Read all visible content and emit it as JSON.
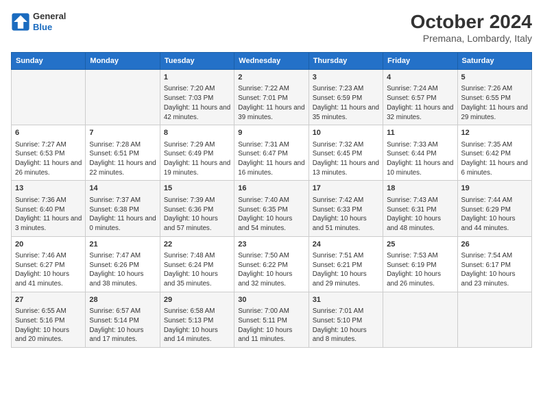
{
  "header": {
    "title": "October 2024",
    "subtitle": "Premana, Lombardy, Italy",
    "logo_line1": "General",
    "logo_line2": "Blue"
  },
  "days_of_week": [
    "Sunday",
    "Monday",
    "Tuesday",
    "Wednesday",
    "Thursday",
    "Friday",
    "Saturday"
  ],
  "weeks": [
    [
      {
        "day": "",
        "info": ""
      },
      {
        "day": "",
        "info": ""
      },
      {
        "day": "1",
        "info": "Sunrise: 7:20 AM\nSunset: 7:03 PM\nDaylight: 11 hours and 42 minutes."
      },
      {
        "day": "2",
        "info": "Sunrise: 7:22 AM\nSunset: 7:01 PM\nDaylight: 11 hours and 39 minutes."
      },
      {
        "day": "3",
        "info": "Sunrise: 7:23 AM\nSunset: 6:59 PM\nDaylight: 11 hours and 35 minutes."
      },
      {
        "day": "4",
        "info": "Sunrise: 7:24 AM\nSunset: 6:57 PM\nDaylight: 11 hours and 32 minutes."
      },
      {
        "day": "5",
        "info": "Sunrise: 7:26 AM\nSunset: 6:55 PM\nDaylight: 11 hours and 29 minutes."
      }
    ],
    [
      {
        "day": "6",
        "info": "Sunrise: 7:27 AM\nSunset: 6:53 PM\nDaylight: 11 hours and 26 minutes."
      },
      {
        "day": "7",
        "info": "Sunrise: 7:28 AM\nSunset: 6:51 PM\nDaylight: 11 hours and 22 minutes."
      },
      {
        "day": "8",
        "info": "Sunrise: 7:29 AM\nSunset: 6:49 PM\nDaylight: 11 hours and 19 minutes."
      },
      {
        "day": "9",
        "info": "Sunrise: 7:31 AM\nSunset: 6:47 PM\nDaylight: 11 hours and 16 minutes."
      },
      {
        "day": "10",
        "info": "Sunrise: 7:32 AM\nSunset: 6:45 PM\nDaylight: 11 hours and 13 minutes."
      },
      {
        "day": "11",
        "info": "Sunrise: 7:33 AM\nSunset: 6:44 PM\nDaylight: 11 hours and 10 minutes."
      },
      {
        "day": "12",
        "info": "Sunrise: 7:35 AM\nSunset: 6:42 PM\nDaylight: 11 hours and 6 minutes."
      }
    ],
    [
      {
        "day": "13",
        "info": "Sunrise: 7:36 AM\nSunset: 6:40 PM\nDaylight: 11 hours and 3 minutes."
      },
      {
        "day": "14",
        "info": "Sunrise: 7:37 AM\nSunset: 6:38 PM\nDaylight: 11 hours and 0 minutes."
      },
      {
        "day": "15",
        "info": "Sunrise: 7:39 AM\nSunset: 6:36 PM\nDaylight: 10 hours and 57 minutes."
      },
      {
        "day": "16",
        "info": "Sunrise: 7:40 AM\nSunset: 6:35 PM\nDaylight: 10 hours and 54 minutes."
      },
      {
        "day": "17",
        "info": "Sunrise: 7:42 AM\nSunset: 6:33 PM\nDaylight: 10 hours and 51 minutes."
      },
      {
        "day": "18",
        "info": "Sunrise: 7:43 AM\nSunset: 6:31 PM\nDaylight: 10 hours and 48 minutes."
      },
      {
        "day": "19",
        "info": "Sunrise: 7:44 AM\nSunset: 6:29 PM\nDaylight: 10 hours and 44 minutes."
      }
    ],
    [
      {
        "day": "20",
        "info": "Sunrise: 7:46 AM\nSunset: 6:27 PM\nDaylight: 10 hours and 41 minutes."
      },
      {
        "day": "21",
        "info": "Sunrise: 7:47 AM\nSunset: 6:26 PM\nDaylight: 10 hours and 38 minutes."
      },
      {
        "day": "22",
        "info": "Sunrise: 7:48 AM\nSunset: 6:24 PM\nDaylight: 10 hours and 35 minutes."
      },
      {
        "day": "23",
        "info": "Sunrise: 7:50 AM\nSunset: 6:22 PM\nDaylight: 10 hours and 32 minutes."
      },
      {
        "day": "24",
        "info": "Sunrise: 7:51 AM\nSunset: 6:21 PM\nDaylight: 10 hours and 29 minutes."
      },
      {
        "day": "25",
        "info": "Sunrise: 7:53 AM\nSunset: 6:19 PM\nDaylight: 10 hours and 26 minutes."
      },
      {
        "day": "26",
        "info": "Sunrise: 7:54 AM\nSunset: 6:17 PM\nDaylight: 10 hours and 23 minutes."
      }
    ],
    [
      {
        "day": "27",
        "info": "Sunrise: 6:55 AM\nSunset: 5:16 PM\nDaylight: 10 hours and 20 minutes."
      },
      {
        "day": "28",
        "info": "Sunrise: 6:57 AM\nSunset: 5:14 PM\nDaylight: 10 hours and 17 minutes."
      },
      {
        "day": "29",
        "info": "Sunrise: 6:58 AM\nSunset: 5:13 PM\nDaylight: 10 hours and 14 minutes."
      },
      {
        "day": "30",
        "info": "Sunrise: 7:00 AM\nSunset: 5:11 PM\nDaylight: 10 hours and 11 minutes."
      },
      {
        "day": "31",
        "info": "Sunrise: 7:01 AM\nSunset: 5:10 PM\nDaylight: 10 hours and 8 minutes."
      },
      {
        "day": "",
        "info": ""
      },
      {
        "day": "",
        "info": ""
      }
    ]
  ]
}
